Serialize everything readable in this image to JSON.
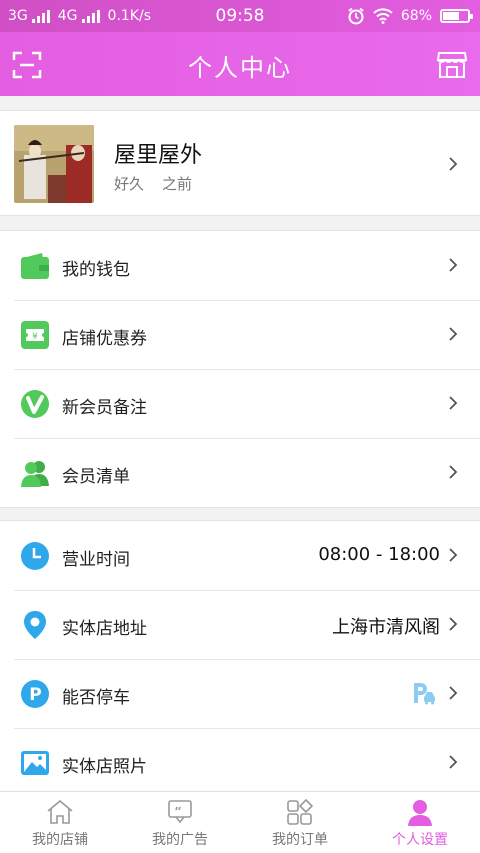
{
  "status": {
    "net1": "3G",
    "net2": "4G",
    "speed": "0.1K/s",
    "time": "09:58",
    "battery_text": "68%",
    "battery_level": 0.68
  },
  "header": {
    "title": "个人中心"
  },
  "profile": {
    "name": "屋里屋外",
    "sub_left": "好久",
    "sub_right": "之前"
  },
  "section1": [
    {
      "label": "我的钱包",
      "icon": "wallet-icon",
      "color": "#52c95b"
    },
    {
      "label": "店铺优惠券",
      "icon": "coupon-icon",
      "color": "#52c95b"
    },
    {
      "label": "新会员备注",
      "icon": "vip-v-icon",
      "color": "#52c95b"
    },
    {
      "label": "会员清单",
      "icon": "members-icon",
      "color": "#52c95b"
    }
  ],
  "section2": [
    {
      "label": "营业时间",
      "value": "08:00 - 18:00",
      "icon": "clock-icon",
      "color": "#2ea8ea"
    },
    {
      "label": "实体店地址",
      "value": "上海市清风阁",
      "icon": "location-pin-icon",
      "color": "#2ea8ea"
    },
    {
      "label": "能否停车",
      "value": "",
      "icon": "parking-icon",
      "color": "#2ea8ea"
    },
    {
      "label": "实体店照片",
      "value": "",
      "icon": "photo-icon",
      "color": "#2ea8ea"
    }
  ],
  "tabs": [
    {
      "label": "我的店铺",
      "icon": "home-icon"
    },
    {
      "label": "我的广告",
      "icon": "ad-icon"
    },
    {
      "label": "我的订单",
      "icon": "orders-icon"
    },
    {
      "label": "个人设置",
      "icon": "person-icon"
    }
  ],
  "colors": {
    "accent": "#e35ee0",
    "green": "#52c95b",
    "blue": "#2ea8ea"
  }
}
